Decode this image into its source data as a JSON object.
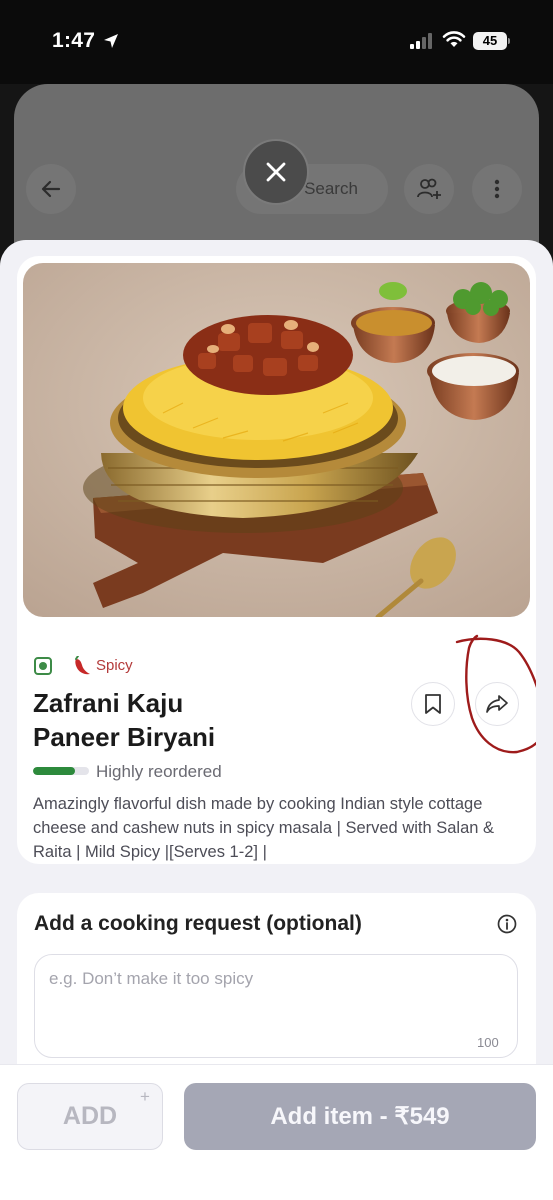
{
  "status_bar": {
    "time": "1:47",
    "battery": "45"
  },
  "underlying_page": {
    "search_label": "Search"
  },
  "dish": {
    "diet_icon": "veg-indicator-icon",
    "spice_tag": "Spicy",
    "name_line1": "Zafrani Kaju",
    "name_line2": "Paneer Biryani",
    "reorder_label": "Highly reordered",
    "reorder_level": 0.75,
    "description": "Amazingly flavorful dish made by cooking Indian style cottage cheese and cashew nuts in spicy masala | Served with Salan & Raita | Mild Spicy |[Serves 1-2] |"
  },
  "cooking_request": {
    "title": "Add a cooking request (optional)",
    "placeholder": "e.g. Don’t make it too spicy",
    "char_limit": "100"
  },
  "bottom_bar": {
    "add_label": "ADD",
    "add_plus": "+",
    "add_item_label": "Add item - ₹549"
  },
  "colors": {
    "veg_green": "#3d8b47",
    "spicy_red": "#b33a3a",
    "reorder_green": "#2d8a3c",
    "annotation_red": "#9e1b1b",
    "disabled_button": "#a5a7b5"
  }
}
